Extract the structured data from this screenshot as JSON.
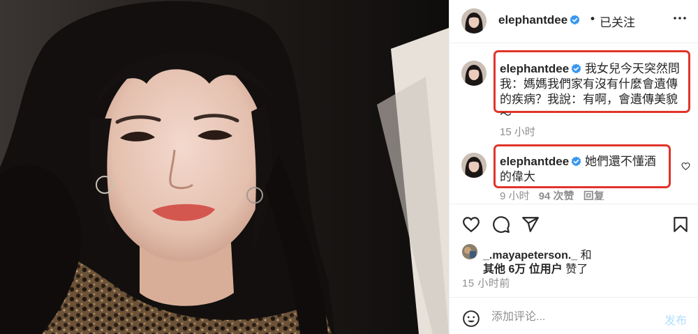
{
  "colors": {
    "highlight": "#e0342a",
    "verified": "#3897f0",
    "meta": "#8e8e8e",
    "post_button": "#b2dffc"
  },
  "header": {
    "username": "elephantdee",
    "separator": "•",
    "follow_state": "已关注",
    "more_icon": "more-horizontal-icon"
  },
  "comments": [
    {
      "username": "elephantdee",
      "text": "我女兒今天突然問我：媽媽我們家有沒有什麼會遺傳的疾病？我說：有啊，會遺傳美貌～",
      "time": "15 小时"
    },
    {
      "username": "elephantdee",
      "text": "她們還不懂酒的偉大",
      "time": "9 小时",
      "likes": "94 次赞",
      "reply": "回复"
    }
  ],
  "likes": {
    "first_user": "_.mayapeterson._",
    "and": "和",
    "others": "其他 6万 位用户",
    "suffix": "赞了"
  },
  "post_time": "15 小时前",
  "add_comment": {
    "placeholder": "添加评论...",
    "post_label": "发布"
  }
}
